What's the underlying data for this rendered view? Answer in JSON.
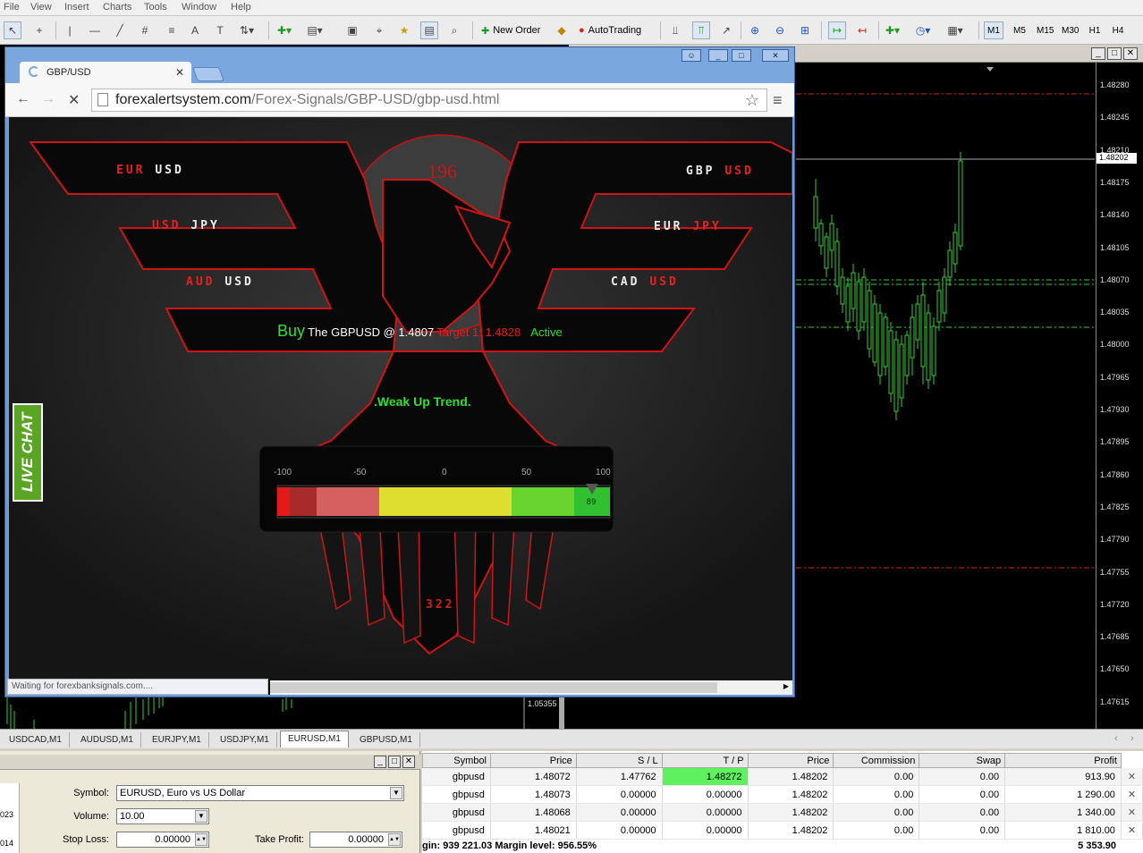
{
  "menu": [
    "File",
    "View",
    "Insert",
    "Charts",
    "Tools",
    "Window",
    "Help"
  ],
  "toolbar": {
    "new_order": "New Order",
    "autotrading": "AutoTrading",
    "timeframes": [
      "M1",
      "M5",
      "M15",
      "M30",
      "H1",
      "H4"
    ],
    "active_tf": "M1"
  },
  "browser": {
    "tab_title": "GBP/USD",
    "url_domain": "forexalertsystem.com",
    "url_path": "/Forex-Signals/GBP-USD/gbp-usd.html",
    "status": "Waiting for forexbanksignals.com...."
  },
  "signal": {
    "counter_top": "196",
    "counter_bottom": "322",
    "pairs_left": [
      {
        "base": "EUR",
        "quote": "USD"
      },
      {
        "base": "USD",
        "quote": "JPY"
      },
      {
        "base": "AUD",
        "quote": "USD"
      }
    ],
    "pairs_right": [
      {
        "base": "GBP",
        "quote": "USD"
      },
      {
        "base": "EUR",
        "quote": "JPY"
      },
      {
        "base": "CAD",
        "quote": "USD"
      }
    ],
    "action": "Buy",
    "text": "The GBPUSD @ 1.4807",
    "target": "Target 1: 1.4828",
    "state": "Active",
    "trend": ".Weak Up Trend.",
    "gauge_ticks": [
      "-100",
      "-50",
      "0",
      "50",
      "100"
    ],
    "gauge_value": "89",
    "gauge_fraction": 0.945
  },
  "live_chat": "LIVE CHAT",
  "chart": {
    "price_ticks": [
      "1.48280",
      "1.48245",
      "1.48210",
      "1.48175",
      "1.48140",
      "1.48105",
      "1.48070",
      "1.48035",
      "1.48000",
      "1.47965",
      "1.47930",
      "1.47895",
      "1.47860",
      "1.47825",
      "1.47790",
      "1.47755",
      "1.47720",
      "1.47685",
      "1.47650",
      "1.47615"
    ],
    "current_price": "1.48202",
    "bg_price": "1.05355",
    "tabs": [
      "USDCAD,M1",
      "AUDUSD,M1",
      "EURJPY,M1",
      "USDJPY,M1",
      "EURUSD,M1",
      "GBPUSD,M1"
    ],
    "active_tab": "EURUSD,M1"
  },
  "order_panel": {
    "symbol_label": "Symbol:",
    "symbol_value": "EURUSD, Euro vs US Dollar",
    "volume_label": "Volume:",
    "volume_value": "10.00",
    "sl_label": "Stop Loss:",
    "sl_value": "0.00000",
    "tp_label": "Take Profit:",
    "tp_value": "0.00000",
    "side_values": [
      "023",
      "014"
    ]
  },
  "trades": {
    "columns": [
      "Symbol",
      "Price",
      "S / L",
      "T / P",
      "Price",
      "Commission",
      "Swap",
      "Profit"
    ],
    "rows": [
      [
        "gbpusd",
        "1.48072",
        "1.47762",
        "1.48272",
        "1.48202",
        "0.00",
        "0.00",
        "913.90"
      ],
      [
        "gbpusd",
        "1.48073",
        "0.00000",
        "0.00000",
        "1.48202",
        "0.00",
        "0.00",
        "1 290.00"
      ],
      [
        "gbpusd",
        "1.48068",
        "0.00000",
        "0.00000",
        "1.48202",
        "0.00",
        "0.00",
        "1 340.00"
      ],
      [
        "gbpusd",
        "1.48021",
        "0.00000",
        "0.00000",
        "1.48202",
        "0.00",
        "0.00",
        "1 810.00"
      ]
    ],
    "footer": "gin: 939 221.03  Margin level: 956.55%",
    "total": "5 353.90"
  }
}
